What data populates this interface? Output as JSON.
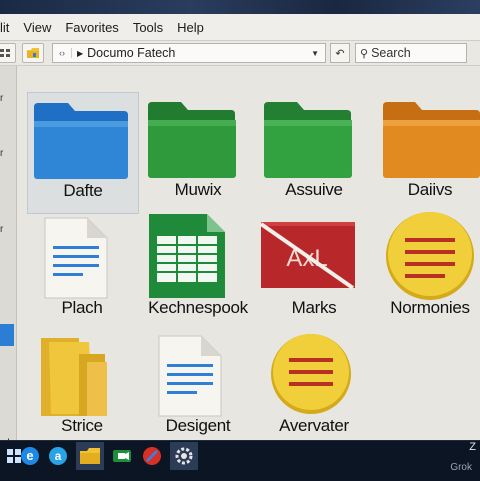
{
  "menubar": {
    "items": [
      "lit",
      "View",
      "Favorites",
      "Tools",
      "Help"
    ]
  },
  "toolbar": {
    "nav_symbol": "‹›",
    "address_text": "Documo Fatech",
    "search_placeholder": "Search"
  },
  "items": [
    {
      "label": "Dafte",
      "icon": "blue-folder-icon",
      "color": "#2f86d6",
      "selected": true
    },
    {
      "label": "Muwix",
      "icon": "green-folder-icon",
      "color": "#2e9a3c"
    },
    {
      "label": "Assuive",
      "icon": "green-folder-icon",
      "color": "#32a140"
    },
    {
      "label": "Daiivs",
      "icon": "orange-folder-icon",
      "color": "#e08a1f"
    },
    {
      "label": "Plach",
      "icon": "text-document-icon",
      "color": "#2f7fd6"
    },
    {
      "label": "Kechnespook",
      "icon": "spreadsheet-icon",
      "color": "#1f8a3a"
    },
    {
      "label": "Marks",
      "icon": "presentation-icon",
      "color": "#b8282a",
      "icon_text": "AxL"
    },
    {
      "label": "Normonies",
      "icon": "notes-icon",
      "color": "#f1cf3a"
    },
    {
      "label": "Strice",
      "icon": "yellow-folder-icon",
      "color": "#f0c63c"
    },
    {
      "label": "Desigent",
      "icon": "text-document-icon",
      "color": "#2f7fd6"
    },
    {
      "label": "Avervater",
      "icon": "notes-icon",
      "color": "#f1cf3a"
    }
  ],
  "tray": {
    "text": "Z"
  },
  "left_marks": [
    "r",
    "r",
    "r",
    "d"
  ],
  "watermark": "Grok"
}
